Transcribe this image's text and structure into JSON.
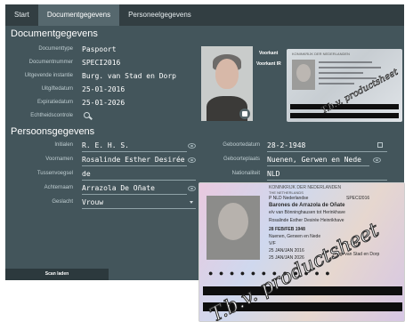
{
  "tabs": [
    {
      "label": "Start"
    },
    {
      "label": "Documentgegevens"
    },
    {
      "label": "Personeelgegevens"
    }
  ],
  "document": {
    "title": "Documentgegevens",
    "fields": [
      {
        "label": "Documenttype",
        "value": "Paspoort"
      },
      {
        "label": "Documentnummer",
        "value": "SPECI2016"
      },
      {
        "label": "Uitgevende instantie",
        "value": "Burg. van Stad en Dorp"
      },
      {
        "label": "Uitgiftedatum",
        "value": "25-01-2016"
      },
      {
        "label": "Expiratiedatum",
        "value": "25-01-2026"
      },
      {
        "label": "Echtheidscontrole",
        "value": ""
      }
    ],
    "front_label": "Voorkant",
    "front_ir_label": "Voorkant IR"
  },
  "person": {
    "title": "Persoonsgegevens",
    "initials": {
      "label": "Initialen",
      "value": "R. E. H. S."
    },
    "first_names": {
      "label": "Voornamen",
      "value": "Rosalinde Esther Desirée H"
    },
    "prefix": {
      "label": "Tussenvoegsel",
      "value": "de"
    },
    "surname": {
      "label": "Achternaam",
      "value": "Arrazola De Oñate"
    },
    "gender": {
      "label": "Geslacht",
      "value": "Vrouw"
    },
    "birth_date": {
      "label": "Geboortedatum",
      "value": "28-2-1948"
    },
    "birth_place": {
      "label": "Geboorteplaats",
      "value": "Nuenen, Gerwen en Nede"
    },
    "nationality": {
      "label": "Nationaliteit",
      "value": "NLD"
    }
  },
  "scan_button": "Scan laden",
  "doc_image": {
    "header": "KONINKRIJK DER NEDERLANDEN",
    "subheader": "THE NETHERLANDS",
    "line1": "P   NLD  Nederlandse",
    "docno": "SPECI2016",
    "name1": "Barones de Arrazola de Oñate",
    "name2": "e/v van Bönninghausen tot Herinkhave",
    "given": "Rosalinde Esther Desirée Heinrikhave",
    "dob": "28 FEB/FEB      1948",
    "pob": "Nuenen, Gerwen en Nede",
    "sex": "V/F",
    "height": "1,75 m",
    "issued": "25 JAN/JAN 2016",
    "expires": "25 JAN/JAN 2026",
    "authority": "Burg. van Stad en Dorp",
    "watermark": "T.b.v. productsheet"
  }
}
